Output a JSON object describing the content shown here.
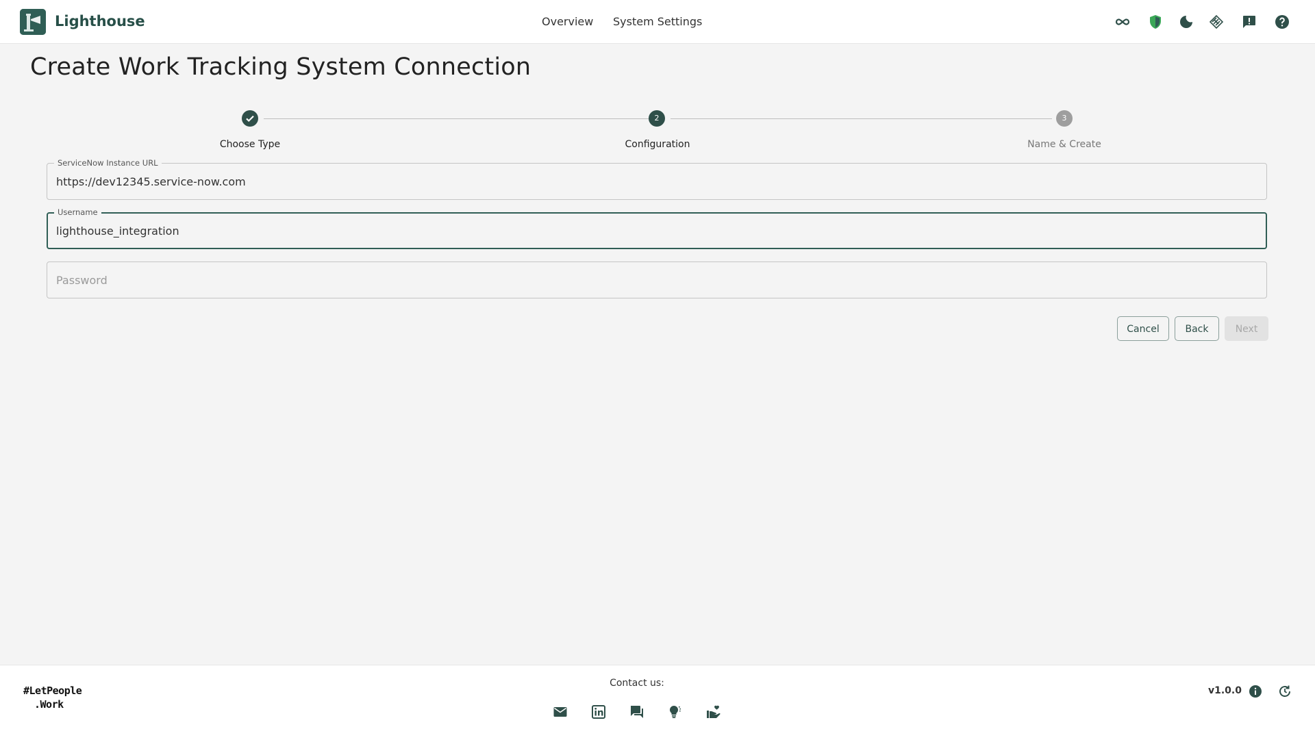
{
  "app": {
    "brand": "Lighthouse",
    "brand_color": "#2f5e55"
  },
  "nav": {
    "overview": "Overview",
    "system_settings": "System Settings"
  },
  "header_icons": [
    "infinity-icon",
    "shield-icon",
    "dark-mode-icon",
    "integration-icon",
    "feedback-icon",
    "help-icon"
  ],
  "page": {
    "title": "Create Work Tracking System Connection"
  },
  "stepper": {
    "steps": [
      {
        "label": "Choose Type",
        "state": "completed",
        "number": "1"
      },
      {
        "label": "Configuration",
        "state": "active",
        "number": "2"
      },
      {
        "label": "Name & Create",
        "state": "pending",
        "number": "3"
      }
    ]
  },
  "form": {
    "url": {
      "label": "ServiceNow Instance URL",
      "value": "https://dev12345.service-now.com"
    },
    "username": {
      "label": "Username",
      "value": "lighthouse_integration"
    },
    "password": {
      "placeholder": "Password",
      "value": ""
    }
  },
  "actions": {
    "cancel": "Cancel",
    "back": "Back",
    "next": "Next"
  },
  "footer": {
    "tagline_line1": "#LetPeople",
    "tagline_line2": ".Work",
    "contact_label": "Contact us:",
    "contact_icons": [
      "email-icon",
      "linkedin-icon",
      "chat-icon",
      "idea-icon",
      "support-icon"
    ],
    "version": "v1.0.0"
  }
}
